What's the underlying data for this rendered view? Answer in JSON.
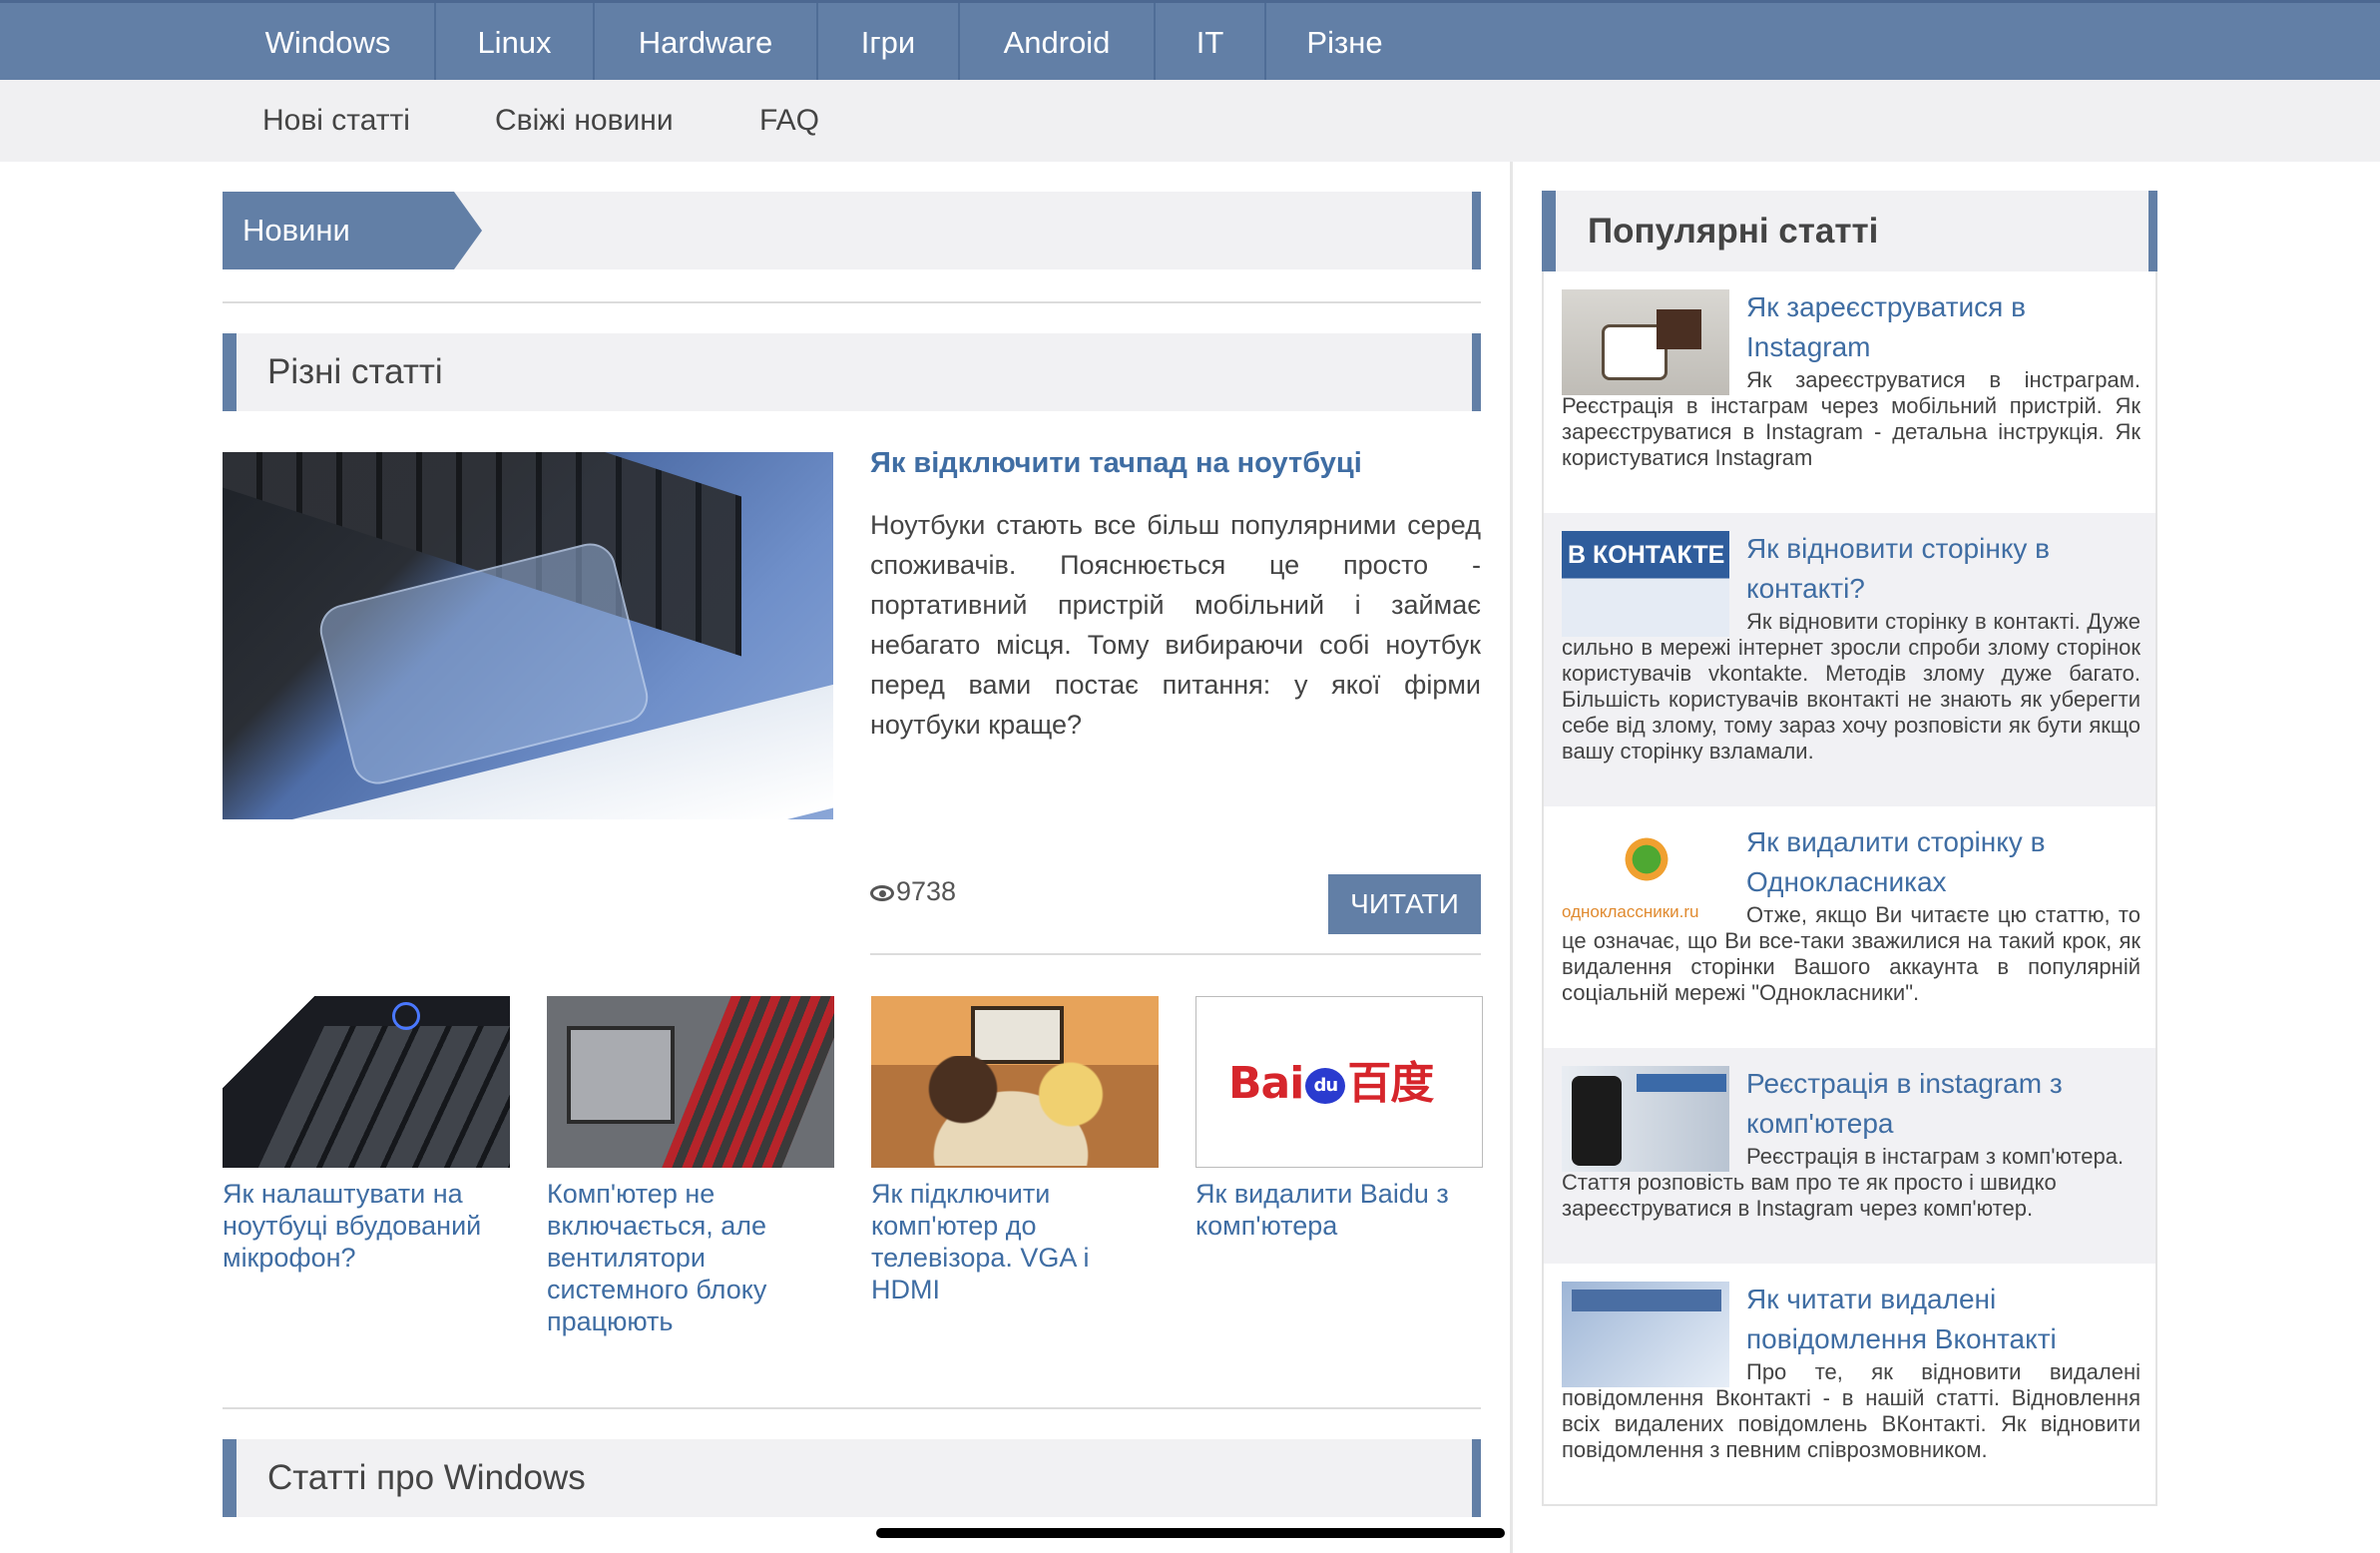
{
  "topnav": {
    "items": [
      "Windows",
      "Linux",
      "Hardware",
      "Ігри",
      "Android",
      "IT",
      "Різне"
    ]
  },
  "subnav": {
    "items": [
      "Нові статті",
      "Свіжі новини",
      "FAQ"
    ]
  },
  "news_section": {
    "title": "Новини"
  },
  "misc_section": {
    "title": "Різні статті"
  },
  "featured": {
    "title": "Як відключити тачпад на ноутбуці",
    "text": "Ноутбуки стають все більш популярними серед споживачів. Пояснюється це просто - портативний пристрій мобільний і займає небагато місця. Тому вибираючи собі ноутбук перед вами постає питання: у якої фірми ноутбуки краще?",
    "views": "9738",
    "read_label": "ЧИТАТИ",
    "image_icon": "laptop-touchpad-photo"
  },
  "thumbs": [
    {
      "caption": "Як налаштувати на ноутбуці вбудований мікрофон?"
    },
    {
      "caption": "Комп'ютер не включається, але вентилятори системного блоку працюють"
    },
    {
      "caption": "Як підключити комп'ютер до телевізора. VGA і HDMI"
    },
    {
      "caption": "Як видалити Baidu з комп'ютера",
      "logo_text_a": "Bai",
      "logo_text_b": "du",
      "logo_text_c": "百度"
    }
  ],
  "windows_section": {
    "title": "Статті про Windows"
  },
  "sidebar": {
    "title": "Популярні статті",
    "items": [
      {
        "title": "Як зареєструватися в Instagram",
        "text": "Як зареєструватися в інстраграм. Реєстрація в інстаграм через мобільний пристрій. Як зареєструватися в Instagram - детальна інструкція. Як користуватися Instagram"
      },
      {
        "title": "Як відновити сторінку в контакті?",
        "text": "Як відновити сторінку в контакті. Дуже сильно в мережі інтернет зросли спроби злому сторінок користувачів vkontakte. Методів злому дуже багато. Більшість користувачів вконтакті не знають як уберегти себе від злому, тому зараз хочу розповісти як бути якщо вашу сторінку взламали.",
        "logo": "В КОНТАКТЕ"
      },
      {
        "title": "Як видалити сторінку в Однокласниках",
        "text": "Отже, якщо Ви читаєте цю статтю, то це означає, що Ви все-таки зважилися на такий крок, як видалення сторінки Вашого аккаунта в популярній соціальній мережі \"Однокласники\".",
        "logo": "одноклассники.ru"
      },
      {
        "title": "Реєстрація в instagram з комп'ютера",
        "text": "Реєстрація в інстаграм з комп'ютера. Стаття розповість вам про те як просто і швидко зареєструватися в Instagram через комп'ютер."
      },
      {
        "title": "Як читати видалені повідомлення Вконтакті",
        "text": "Про те, як відновити видалені повідомлення Вконтакті - в нашій статті. Відновлення всіх видалених повідомлень ВКонтакті. Як відновити повідомлення з певним співрозмовником."
      }
    ]
  },
  "colors": {
    "accent": "#627fa6",
    "link": "#3f6da3",
    "bar_bg": "#f1f1f3"
  }
}
